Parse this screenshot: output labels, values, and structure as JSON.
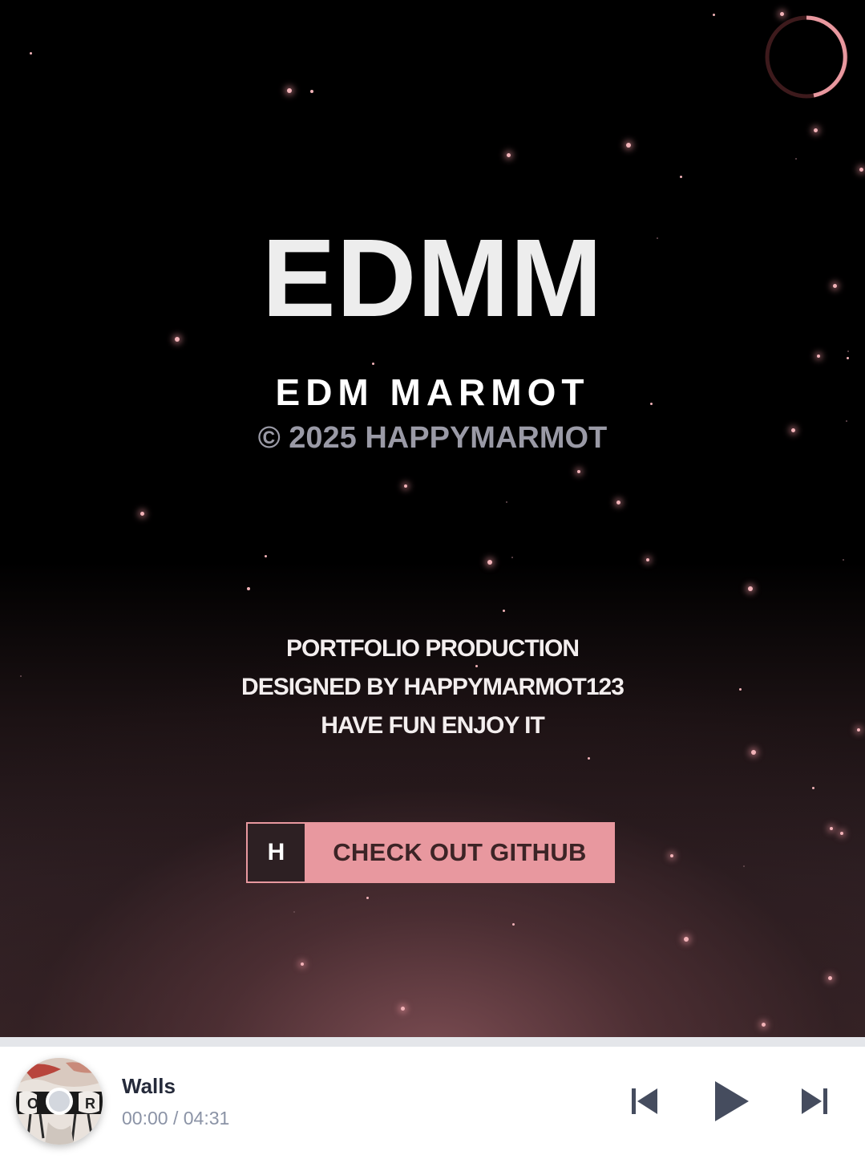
{
  "hero": {
    "title": "EDMM",
    "subtitle": "EDM MARMOT",
    "copyright": "© 2025 HAPPYMARMOT",
    "tagline": [
      "PORTFOLIO PRODUCTION",
      "DESIGNED BY HAPPYMARMOT123",
      "HAVE FUN ENJOY IT"
    ],
    "cta": {
      "key": "H",
      "label": "CHECK OUT GITHUB"
    },
    "loader_icon": "loading-ring-icon"
  },
  "player": {
    "track_title": "Walls",
    "current_time": "00:00",
    "time_separator": "/",
    "duration": "04:31",
    "progress": 0,
    "controls": {
      "previous_icon": "skip-previous-icon",
      "play_icon": "play-icon",
      "next_icon": "skip-next-icon"
    }
  },
  "colors": {
    "accent": "#e8989f",
    "text_dark": "#252a3a",
    "text_muted": "#8b93a6",
    "control": "#454c5e"
  }
}
